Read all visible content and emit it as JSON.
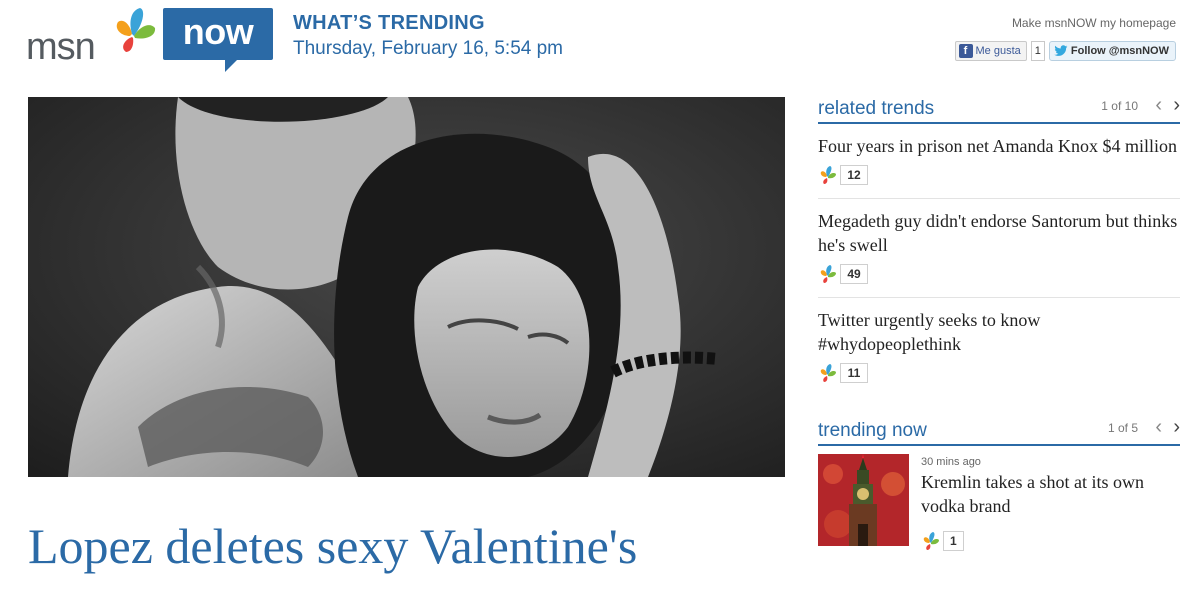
{
  "header": {
    "brand": "msn",
    "brand_badge": "now",
    "section_title": "WHAT’S TRENDING",
    "dateline": "Thursday, February 16, 5:54 pm",
    "homepage_link": "Make msnNOW my homepage",
    "facebook_label": "Me gusta",
    "facebook_count": "1",
    "twitter_label": "Follow @msnNOW"
  },
  "main": {
    "headline": "Lopez deletes sexy Valentine's"
  },
  "related": {
    "title": "related trends",
    "pager": "1 of 10",
    "items": [
      {
        "title": "Four years in prison net Amanda Knox $4 million",
        "count": "12"
      },
      {
        "title": "Megadeth guy didn't endorse Santorum but thinks he's swell",
        "count": "49"
      },
      {
        "title": "Twitter urgently seeks to know #whydopeoplethink",
        "count": "11"
      }
    ]
  },
  "trending": {
    "title": "trending now",
    "pager": "1 of 5",
    "items": [
      {
        "time": "30 mins ago",
        "title": "Kremlin takes a shot at its own vodka brand",
        "count": "1"
      }
    ]
  },
  "colors": {
    "brand_blue": "#2b6aa6",
    "text_dark": "#222222",
    "rule_gray": "#e3e3e3"
  },
  "icons": {
    "prev": "chevron-left-icon",
    "next": "chevron-right-icon",
    "logo": "msn-butterfly-icon"
  }
}
